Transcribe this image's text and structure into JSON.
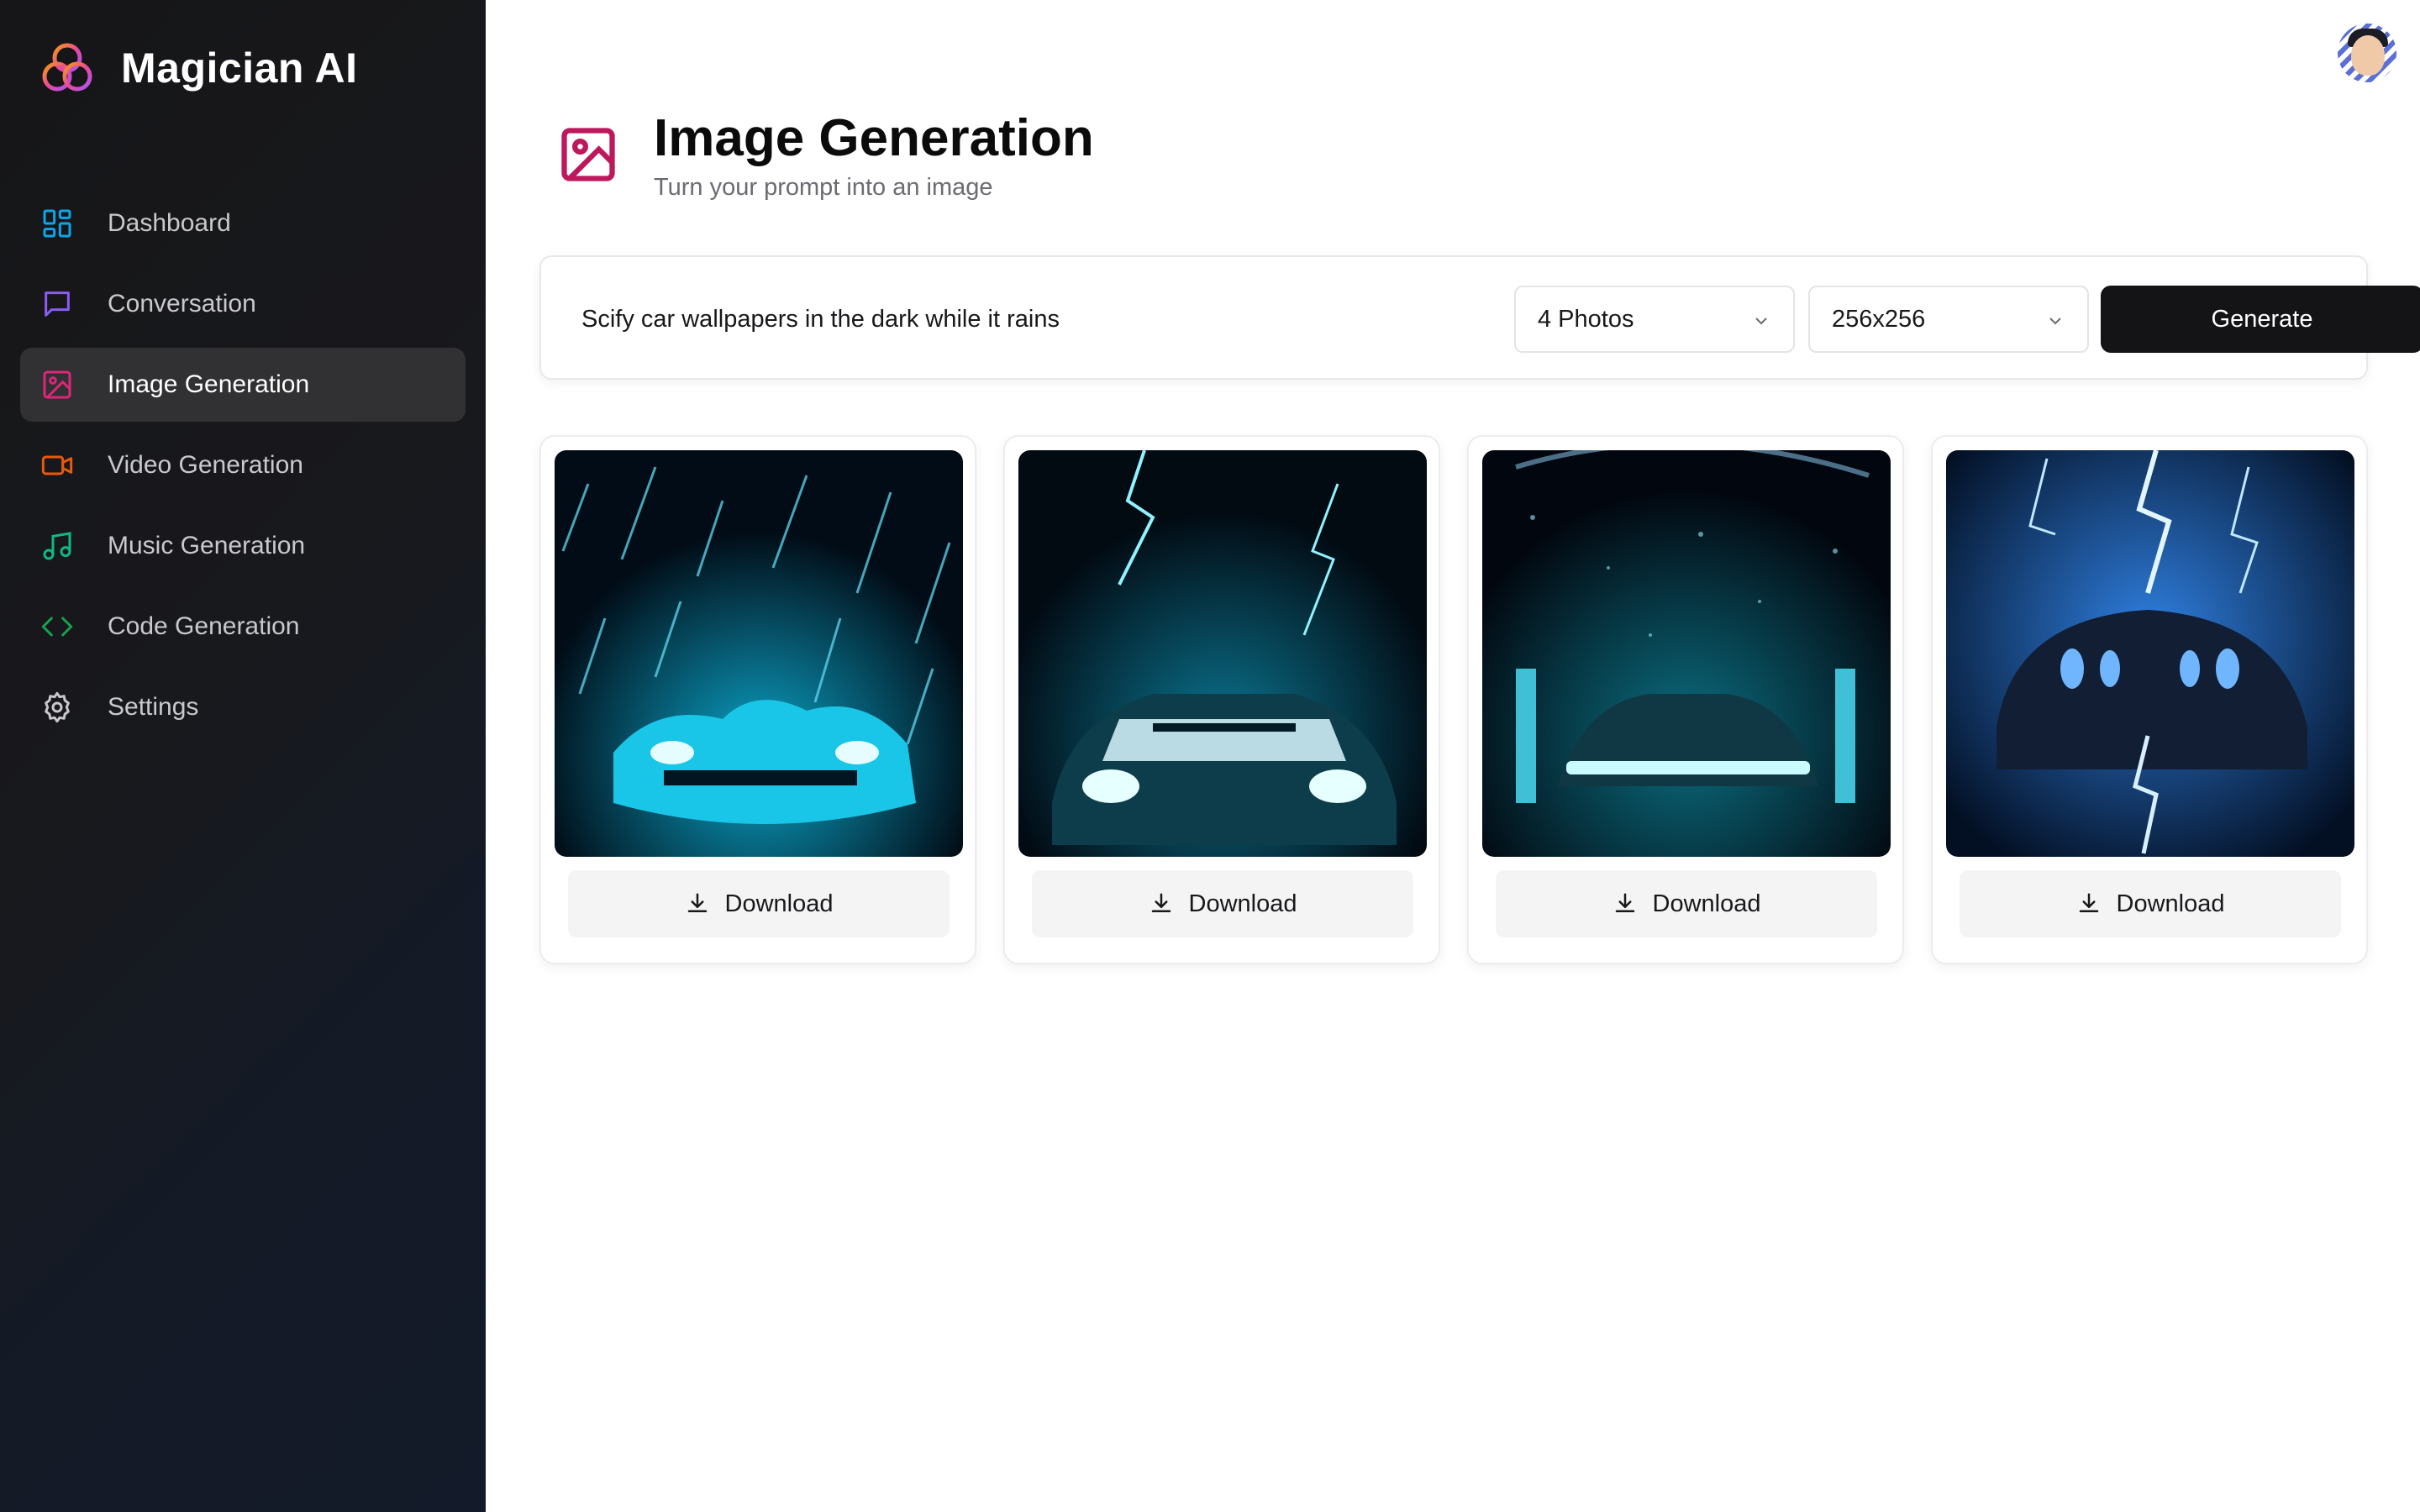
{
  "app": {
    "name": "Magician AI"
  },
  "sidebar": {
    "items": [
      {
        "label": "Dashboard",
        "icon": "grid-icon",
        "color": "#0ea5e9"
      },
      {
        "label": "Conversation",
        "icon": "chat-icon",
        "color": "#8b5cf6"
      },
      {
        "label": "Image Generation",
        "icon": "image-icon",
        "color": "#db2777",
        "active": true
      },
      {
        "label": "Video Generation",
        "icon": "video-icon",
        "color": "#ea580c"
      },
      {
        "label": "Music Generation",
        "icon": "music-icon",
        "color": "#10b981"
      },
      {
        "label": "Code Generation",
        "icon": "code-icon",
        "color": "#16a34a"
      },
      {
        "label": "Settings",
        "icon": "gear-icon",
        "color": "#c9c9cd"
      }
    ]
  },
  "header": {
    "title": "Image Generation",
    "subtitle": "Turn your prompt into an image",
    "icon": "image-icon",
    "accent": "#be185d"
  },
  "prompt": {
    "value": "Scify car wallpapers in the dark while it rains",
    "count_value": "4 Photos",
    "size_value": "256x256",
    "generate_label": "Generate"
  },
  "gallery": {
    "images": [
      {
        "download_label": "Download"
      },
      {
        "download_label": "Download"
      },
      {
        "download_label": "Download"
      },
      {
        "download_label": "Download"
      }
    ]
  }
}
